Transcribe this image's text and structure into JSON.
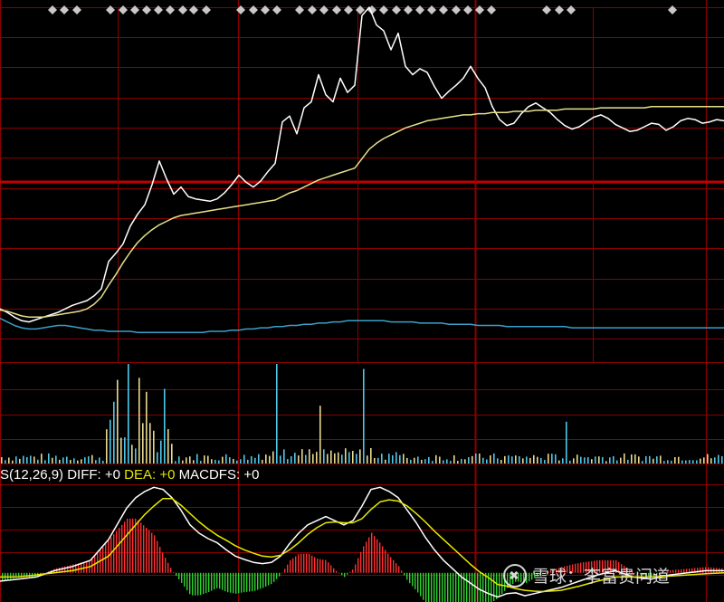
{
  "colors": {
    "background": "#000000",
    "grid": "#8a0000",
    "zero_line": "#c00000",
    "price_line": "#ffffff",
    "avg_price_line": "#e6e08a",
    "lower_line": "#3aa0c8",
    "vol_up": "#e8d890",
    "vol_down": "#50c8e8",
    "diff_line": "#ffffff",
    "dea_line": "#e8e800",
    "macd_pos": "#ff3030",
    "macd_neg": "#30d030",
    "marker": "#c8c8c8"
  },
  "macd_header": {
    "name": "S(12,26,9)",
    "diff_label": "DIFF:",
    "diff_value": "+0",
    "dea_label": "DEA:",
    "dea_value": "+0",
    "macdfs_label": "MACDFS:",
    "macdfs_value": "+0"
  },
  "watermark": {
    "text": "雪球：李富贵问道"
  },
  "chart_data": [
    {
      "type": "line",
      "panel": "price",
      "x": [
        0,
        8,
        16,
        24,
        32,
        40,
        48,
        56,
        64,
        72,
        80,
        88,
        96,
        104,
        112,
        120,
        128,
        136,
        144,
        152,
        160,
        168,
        176,
        184,
        192,
        200,
        208,
        216,
        224,
        232,
        240,
        248,
        256,
        264,
        272,
        280,
        288,
        296,
        304,
        312,
        320,
        328,
        336,
        344,
        352,
        360,
        368,
        376,
        384,
        392,
        400,
        408,
        416,
        424,
        432,
        440,
        448,
        456,
        464,
        472,
        480,
        488,
        496,
        504,
        512,
        520,
        528,
        536,
        544,
        552,
        560,
        568,
        576,
        584,
        592,
        600,
        608,
        616,
        624,
        632,
        640,
        648,
        656,
        664,
        672,
        680,
        688,
        696,
        704,
        712,
        720,
        728,
        736,
        744,
        752,
        760,
        768,
        776,
        784,
        792,
        800
      ],
      "series": [
        {
          "values": [
            0.5,
            0.2,
            -0.2,
            -0.5,
            -0.6,
            -0.4,
            -0.2,
            0.0,
            0.2,
            0.5,
            0.8,
            1.0,
            1.2,
            1.6,
            2.2,
            4.5,
            5.2,
            6.0,
            7.5,
            8.5,
            9.3,
            11.0,
            13.0,
            11.5,
            10.2,
            10.8,
            10.0,
            9.8,
            9.7,
            9.6,
            9.8,
            10.3,
            11.0,
            11.8,
            11.2,
            10.8,
            11.3,
            12.1,
            12.8,
            16.3,
            16.8,
            15.3,
            17.5,
            18.0,
            20.3,
            18.6,
            18.0,
            20.0,
            18.8,
            19.4,
            25.3,
            26.0,
            24.5,
            24.0,
            22.4,
            23.8,
            21.0,
            20.3,
            20.8,
            20.5,
            19.3,
            18.3,
            18.9,
            19.4,
            20.0,
            21.0,
            20.0,
            19.2,
            17.6,
            16.5,
            16.0,
            16.2,
            17.0,
            17.6,
            17.9,
            17.5,
            17.1,
            16.5,
            16.0,
            15.7,
            15.9,
            16.3,
            16.7,
            16.9,
            16.6,
            16.1,
            15.8,
            15.5,
            15.6,
            15.9,
            16.2,
            16.1,
            15.6,
            15.9,
            16.4,
            16.6,
            16.5,
            16.2,
            16.3,
            16.5,
            16.4
          ]
        },
        {
          "values": [
            0.4,
            0.3,
            0.1,
            -0.1,
            -0.2,
            -0.2,
            -0.2,
            -0.1,
            0.0,
            0.1,
            0.2,
            0.3,
            0.5,
            0.9,
            1.5,
            2.5,
            3.4,
            4.4,
            5.3,
            6.1,
            6.7,
            7.2,
            7.6,
            7.9,
            8.2,
            8.4,
            8.5,
            8.6,
            8.7,
            8.8,
            8.9,
            9.0,
            9.1,
            9.2,
            9.3,
            9.4,
            9.5,
            9.6,
            9.7,
            10.0,
            10.3,
            10.5,
            10.8,
            11.1,
            11.4,
            11.6,
            11.8,
            12.0,
            12.2,
            12.4,
            13.2,
            14.0,
            14.5,
            14.9,
            15.2,
            15.5,
            15.8,
            16.0,
            16.2,
            16.4,
            16.5,
            16.6,
            16.7,
            16.8,
            16.9,
            16.9,
            17.0,
            17.0,
            17.1,
            17.1,
            17.1,
            17.2,
            17.2,
            17.2,
            17.3,
            17.3,
            17.3,
            17.3,
            17.4,
            17.4,
            17.4,
            17.4,
            17.4,
            17.5,
            17.5,
            17.5,
            17.5,
            17.5,
            17.5,
            17.5,
            17.6,
            17.6,
            17.6,
            17.6,
            17.6,
            17.6,
            17.6,
            17.6,
            17.6,
            17.6,
            17.6
          ]
        },
        {
          "values": [
            -0.3,
            -0.6,
            -0.9,
            -1.1,
            -1.2,
            -1.2,
            -1.1,
            -1.0,
            -0.9,
            -0.9,
            -1.0,
            -1.1,
            -1.2,
            -1.3,
            -1.3,
            -1.4,
            -1.4,
            -1.4,
            -1.4,
            -1.5,
            -1.5,
            -1.5,
            -1.5,
            -1.5,
            -1.5,
            -1.5,
            -1.5,
            -1.5,
            -1.5,
            -1.4,
            -1.4,
            -1.4,
            -1.3,
            -1.3,
            -1.2,
            -1.2,
            -1.1,
            -1.1,
            -1.0,
            -1.0,
            -0.9,
            -0.9,
            -0.8,
            -0.8,
            -0.7,
            -0.7,
            -0.6,
            -0.6,
            -0.5,
            -0.5,
            -0.5,
            -0.5,
            -0.5,
            -0.5,
            -0.6,
            -0.6,
            -0.6,
            -0.6,
            -0.7,
            -0.7,
            -0.7,
            -0.7,
            -0.8,
            -0.8,
            -0.8,
            -0.8,
            -0.9,
            -0.9,
            -0.9,
            -0.9,
            -1.0,
            -1.0,
            -1.0,
            -1.0,
            -1.0,
            -1.0,
            -1.0,
            -1.0,
            -1.0,
            -1.1,
            -1.1,
            -1.1,
            -1.1,
            -1.1,
            -1.1,
            -1.1,
            -1.1,
            -1.1,
            -1.1,
            -1.1,
            -1.1,
            -1.1,
            -1.1,
            -1.1,
            -1.1,
            -1.1,
            -1.1,
            -1.1,
            -1.1,
            -1.1,
            -1.1
          ]
        }
      ],
      "ylim": [
        -4.0,
        26.0
      ]
    },
    {
      "type": "bar",
      "panel": "volume",
      "bars_count": 200,
      "peaks": [
        {
          "index": 31,
          "value": 0.62
        },
        {
          "index": 32,
          "value": 0.84
        },
        {
          "index": 35,
          "value": 1.0
        },
        {
          "index": 38,
          "value": 0.86
        },
        {
          "index": 40,
          "value": 0.72
        },
        {
          "index": 45,
          "value": 0.75
        },
        {
          "index": 76,
          "value": 1.0
        },
        {
          "index": 88,
          "value": 0.58
        },
        {
          "index": 100,
          "value": 0.95
        },
        {
          "index": 156,
          "value": 0.42
        }
      ],
      "ylim": [
        0,
        1.0
      ]
    },
    {
      "type": "line",
      "panel": "macd",
      "x": [
        0,
        20,
        40,
        60,
        80,
        100,
        120,
        140,
        150,
        160,
        170,
        180,
        190,
        200,
        210,
        220,
        230,
        240,
        250,
        260,
        270,
        280,
        290,
        300,
        310,
        320,
        330,
        340,
        350,
        360,
        370,
        380,
        390,
        400,
        410,
        420,
        430,
        440,
        450,
        460,
        470,
        480,
        490,
        500,
        510,
        520,
        530,
        540,
        550,
        560,
        570,
        580,
        590,
        600,
        620,
        640,
        660,
        680,
        700,
        720,
        740,
        760,
        780,
        800
      ],
      "series": [
        {
          "values": [
            -0.2,
            -0.15,
            -0.1,
            0.05,
            0.15,
            0.3,
            0.8,
            1.55,
            1.8,
            1.95,
            2.05,
            2.0,
            1.8,
            1.5,
            1.15,
            0.95,
            0.82,
            0.72,
            0.55,
            0.4,
            0.32,
            0.25,
            0.22,
            0.25,
            0.4,
            0.7,
            0.95,
            1.15,
            1.25,
            1.35,
            1.25,
            1.15,
            1.25,
            1.6,
            2.0,
            2.05,
            1.95,
            1.8,
            1.5,
            1.2,
            0.85,
            0.55,
            0.3,
            0.1,
            -0.1,
            -0.25,
            -0.4,
            -0.5,
            -0.58,
            -0.5,
            -0.48,
            -0.55,
            -0.5,
            -0.45,
            -0.35,
            -0.2,
            -0.05,
            0.05,
            -0.1,
            -0.15,
            -0.05,
            0.0,
            0.05,
            0.05
          ]
        },
        {
          "values": [
            -0.1,
            -0.1,
            -0.05,
            0.0,
            0.05,
            0.15,
            0.4,
            0.9,
            1.15,
            1.4,
            1.6,
            1.78,
            1.78,
            1.62,
            1.42,
            1.22,
            1.05,
            0.9,
            0.78,
            0.65,
            0.55,
            0.47,
            0.4,
            0.38,
            0.42,
            0.55,
            0.72,
            0.92,
            1.08,
            1.2,
            1.22,
            1.2,
            1.2,
            1.3,
            1.52,
            1.7,
            1.75,
            1.72,
            1.6,
            1.42,
            1.22,
            1.0,
            0.8,
            0.6,
            0.4,
            0.2,
            0.02,
            -0.12,
            -0.28,
            -0.32,
            -0.38,
            -0.42,
            -0.44,
            -0.45,
            -0.42,
            -0.32,
            -0.2,
            -0.1,
            -0.1,
            -0.1,
            -0.08,
            -0.05,
            -0.02,
            0.0
          ]
        }
      ],
      "ylim": [
        -0.7,
        2.1
      ]
    }
  ]
}
